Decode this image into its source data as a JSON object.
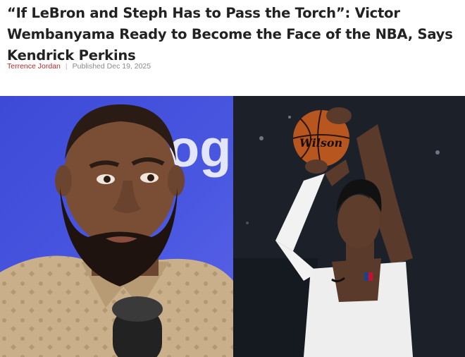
{
  "article": {
    "headline": "“If LeBron and Steph Has to Pass the Torch”: Victor Wembanyama Ready to Become the Face of the NBA, Says Kendrick Perkins",
    "author": "Terrence Jordan",
    "separator": "|",
    "published": "Published Dec 19, 2025"
  },
  "hero": {
    "left_photo_backdrop_text": "ogl",
    "right_photo_ball_brand": "Wilson"
  },
  "colors": {
    "author_link": "#b02b2c",
    "left_backdrop": "#4451dc",
    "right_backdrop": "#1a1e26"
  }
}
